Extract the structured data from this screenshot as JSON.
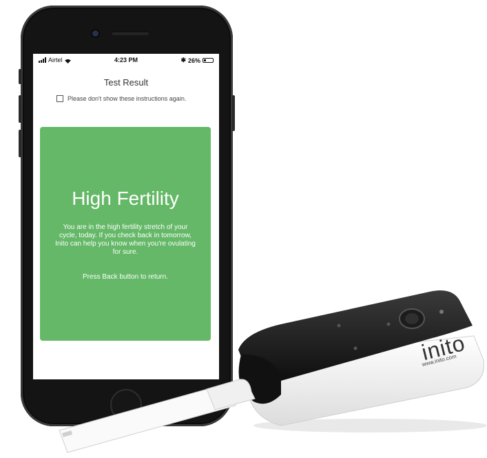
{
  "statusbar": {
    "carrier": "Airtel",
    "time": "4:23 PM",
    "battery": "26%",
    "battery_level": 0.26,
    "signal_icon": "signal-icon",
    "wifi_icon": "wifi-icon",
    "bluetooth_icon": "bluetooth-icon",
    "battery_icon": "battery-icon"
  },
  "screen": {
    "title": "Test Result",
    "checkbox_label": "Please don't show these instructions again.",
    "checkbox_checked": false
  },
  "result": {
    "title": "High Fertility",
    "description": "You are in the high fertility stretch of your cycle, today. If you check back in tomorrow, Inito can help you know when you're ovulating for sure.",
    "hint": "Press Back button to return.",
    "color": "#64b867"
  },
  "device": {
    "brand": "inito",
    "url": "www.inito.com"
  }
}
